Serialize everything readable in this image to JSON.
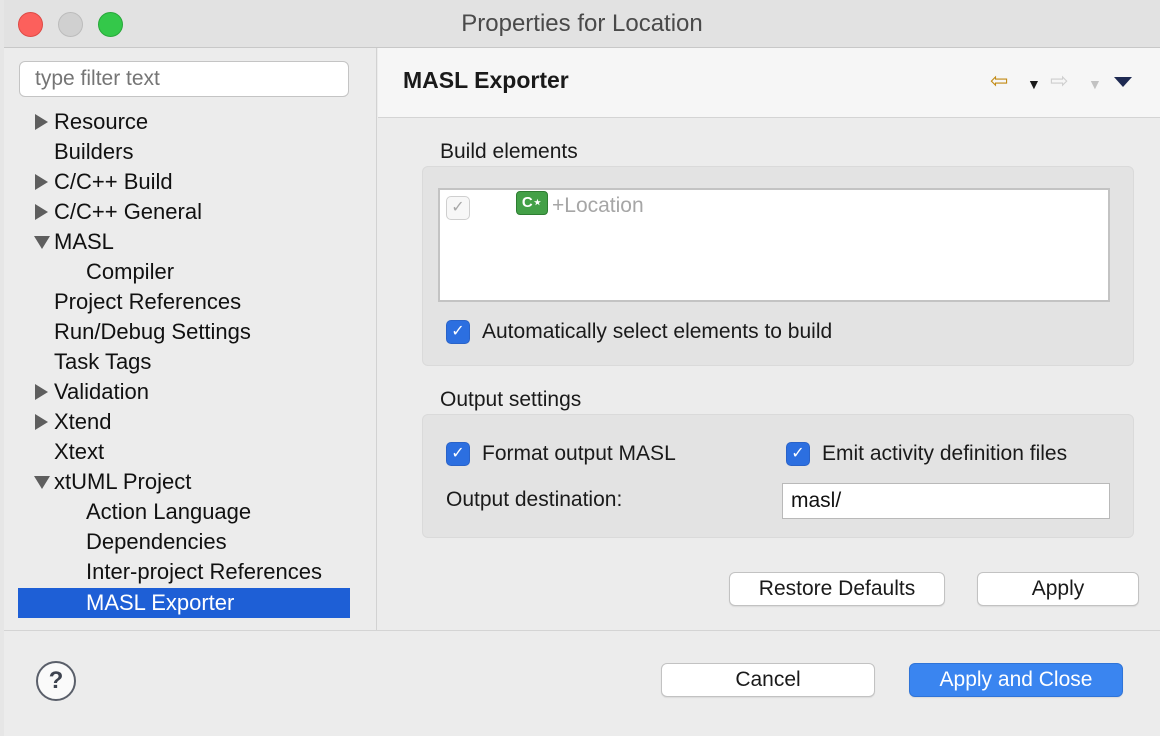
{
  "window": {
    "title": "Properties for Location"
  },
  "filter": {
    "placeholder": "type filter text"
  },
  "tree": [
    {
      "label": "Resource",
      "expander": "collapsed"
    },
    {
      "label": "Builders",
      "expander": "none"
    },
    {
      "label": "C/C++ Build",
      "expander": "collapsed"
    },
    {
      "label": "C/C++ General",
      "expander": "collapsed"
    },
    {
      "label": "MASL",
      "expander": "expanded"
    },
    {
      "label": "Compiler",
      "expander": "none"
    },
    {
      "label": "Project References",
      "expander": "none"
    },
    {
      "label": "Run/Debug Settings",
      "expander": "none"
    },
    {
      "label": "Task Tags",
      "expander": "none"
    },
    {
      "label": "Validation",
      "expander": "collapsed"
    },
    {
      "label": "Xtend",
      "expander": "collapsed"
    },
    {
      "label": "Xtext",
      "expander": "none"
    },
    {
      "label": "xtUML Project",
      "expander": "expanded"
    },
    {
      "label": "Action Language",
      "expander": "none"
    },
    {
      "label": "Dependencies",
      "expander": "none"
    },
    {
      "label": "Inter-project References",
      "expander": "none"
    },
    {
      "label": "MASL Exporter",
      "expander": "none",
      "selected": true
    }
  ],
  "page": {
    "title": "MASL Exporter",
    "icons": [
      "back-arrow-icon",
      "forward-arrow-icon",
      "view-menu-icon"
    ],
    "build_elements": {
      "label": "Build elements",
      "items": [
        {
          "icon": "class-icon",
          "icon_glyph": "C",
          "label": "+Location",
          "checked": true,
          "enabled": false
        }
      ],
      "auto_select_label": "Automatically select elements to build",
      "auto_select_checked": true
    },
    "output_settings": {
      "label": "Output settings",
      "format_label": "Format output MASL",
      "format_checked": true,
      "emit_label": "Emit activity definition files",
      "emit_checked": true,
      "destination_label": "Output destination:",
      "destination_value": "masl/"
    },
    "restore_defaults_label": "Restore Defaults",
    "apply_label": "Apply"
  },
  "footer": {
    "help_glyph": "?",
    "cancel_label": "Cancel",
    "apply_close_label": "Apply and Close"
  },
  "colors": {
    "selection": "#1e5fd6",
    "primary_button": "#3a85f0",
    "checkbox": "#2c6fe0",
    "back_arrow": "#c28a14",
    "class_icon": "#43a047"
  }
}
